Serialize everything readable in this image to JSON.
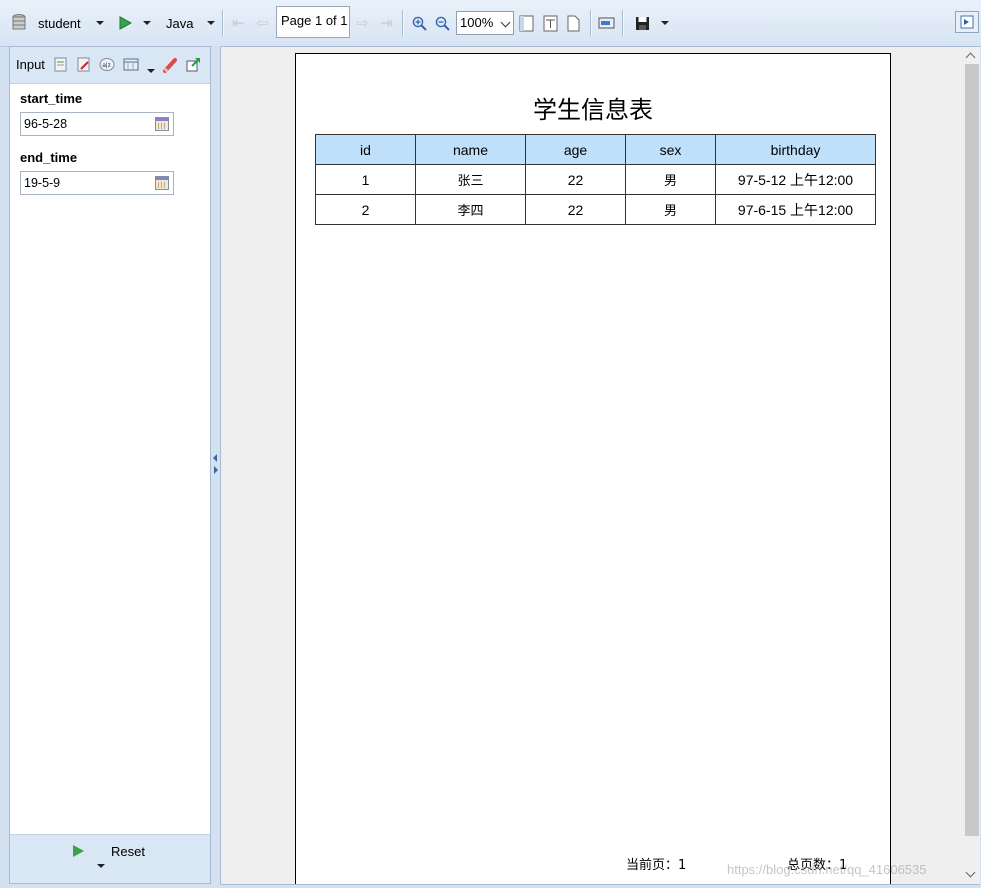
{
  "toolbar": {
    "report_name": "student",
    "language": "Java",
    "page_indicator": "Page 1 of 1",
    "zoom": "100%"
  },
  "params_panel": {
    "title": "Input",
    "fields": [
      {
        "label": "start_time",
        "value": "96-5-28"
      },
      {
        "label": "end_time",
        "value": "19-5-9"
      }
    ],
    "reset_label": "Reset"
  },
  "report": {
    "title": "学生信息表",
    "columns": [
      "id",
      "name",
      "age",
      "sex",
      "birthday"
    ],
    "rows": [
      [
        "1",
        "张三",
        "22",
        "男",
        "97-5-12 上午12:00"
      ],
      [
        "2",
        "李四",
        "22",
        "男",
        "97-6-15 上午12:00"
      ]
    ],
    "current_page_label": "当前页：",
    "current_page": "1",
    "total_pages_label": "总页数：",
    "total_pages": "1"
  },
  "colors": {
    "header_fill": "#bfe0fb",
    "chrome": "#d4e1f0",
    "run_green": "#3aa24a"
  },
  "watermark": "https://blog.csdn.net/qq_41606535"
}
